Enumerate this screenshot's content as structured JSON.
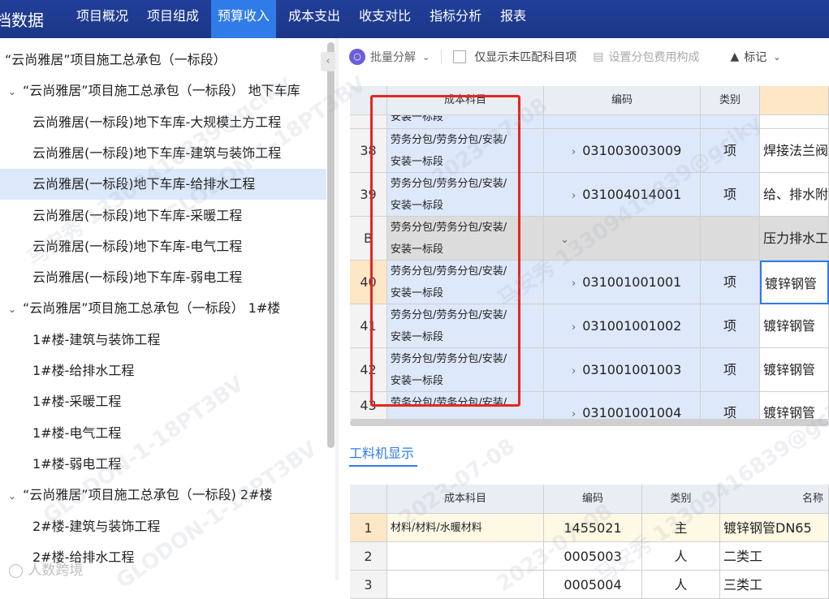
{
  "nav": {
    "app_title": "档数据",
    "tabs": [
      "项目概况",
      "项目组成",
      "预算收入",
      "成本支出",
      "收支对比",
      "指标分析",
      "报表"
    ],
    "active_tab": "预算收入"
  },
  "tree": {
    "items": [
      {
        "label": "“云尚雅居”项目施工总承包（一标段）",
        "level": 0,
        "caret": ""
      },
      {
        "label": "“云尚雅居”项目施工总承包（一标段） 地下车库",
        "level": 1,
        "caret": "⌄"
      },
      {
        "label": "云尚雅居(一标段)地下车库-大规模土方工程",
        "level": 2,
        "caret": ""
      },
      {
        "label": "云尚雅居(一标段)地下车库-建筑与装饰工程",
        "level": 2,
        "caret": ""
      },
      {
        "label": "云尚雅居(一标段)地下车库-给排水工程",
        "level": 2,
        "caret": "",
        "selected": true
      },
      {
        "label": "云尚雅居(一标段)地下车库-采暖工程",
        "level": 2,
        "caret": ""
      },
      {
        "label": "云尚雅居(一标段)地下车库-电气工程",
        "level": 2,
        "caret": ""
      },
      {
        "label": "云尚雅居(一标段)地下车库-弱电工程",
        "level": 2,
        "caret": ""
      },
      {
        "label": "“云尚雅居”项目施工总承包（一标段） 1#楼",
        "level": 1,
        "caret": "⌄"
      },
      {
        "label": "1#楼-建筑与装饰工程",
        "level": 2,
        "caret": ""
      },
      {
        "label": "1#楼-给排水工程",
        "level": 2,
        "caret": ""
      },
      {
        "label": "1#楼-采暖工程",
        "level": 2,
        "caret": ""
      },
      {
        "label": "1#楼-电气工程",
        "level": 2,
        "caret": ""
      },
      {
        "label": "1#楼-弱电工程",
        "level": 2,
        "caret": ""
      },
      {
        "label": "“云尚雅居”项目施工总承包（一标段) 2#楼",
        "level": 1,
        "caret": "⌄"
      },
      {
        "label": "2#楼-建筑与装饰工程",
        "level": 2,
        "caret": ""
      },
      {
        "label": "2#楼-给排水工程",
        "level": 2,
        "caret": ""
      }
    ]
  },
  "toolbar": {
    "batch_decompose": "批量分解",
    "only_unmatched": "仅显示未匹配科目项",
    "set_subcontract": "设置分包费用构成",
    "mark": "标记"
  },
  "main_table": {
    "headers": [
      "成本科目",
      "编码",
      "类别"
    ],
    "top_partial": "安装一标段",
    "rows": [
      {
        "num": "38",
        "subject1": "劳务分包/劳务分包/安装/",
        "subject2": "安装一标段",
        "code": "031003003009",
        "type": "项",
        "name": "焊接法兰阀门",
        "style": "blue"
      },
      {
        "num": "39",
        "subject1": "劳务分包/劳务分包/安装/",
        "subject2": "安装一标段",
        "code": "031004014001",
        "type": "项",
        "name": "给、排水附(配",
        "style": "blue"
      },
      {
        "num": "B",
        "subject1": "劳务分包/劳务分包/安装/",
        "subject2": "安装一标段",
        "code": "",
        "type": "",
        "name": "压力排水工程",
        "style": "gray"
      },
      {
        "num": "40",
        "subject1": "劳务分包/劳务分包/安装/",
        "subject2": "安装一标段",
        "code": "031001001001",
        "type": "项",
        "name": "镀锌钢管",
        "style": "blue-active"
      },
      {
        "num": "41",
        "subject1": "劳务分包/劳务分包/安装/",
        "subject2": "安装一标段",
        "code": "031001001002",
        "type": "项",
        "name": "镀锌钢管",
        "style": "blue"
      },
      {
        "num": "42",
        "subject1": "劳务分包/劳务分包/安装/",
        "subject2": "安装一标段",
        "code": "031001001003",
        "type": "项",
        "name": "镀锌钢管",
        "style": "blue"
      },
      {
        "num": "43",
        "subject1": "劳务分包/劳务分包/安装/",
        "subject2": "",
        "code": "031001001004",
        "type": "项",
        "name": "镀锌钢管",
        "style": "blue"
      }
    ]
  },
  "bottom": {
    "tab_label": "工料机显示",
    "headers": [
      "成本科目",
      "编码",
      "类别",
      "名称"
    ],
    "rows": [
      {
        "num": "1",
        "subject": "材料/材料/水暖材料",
        "code": "1455021",
        "type": "主",
        "name": "镀锌钢管DN65"
      },
      {
        "num": "2",
        "subject": "",
        "code": "0005003",
        "type": "人",
        "name": "二类工"
      },
      {
        "num": "3",
        "subject": "",
        "code": "0005004",
        "type": "人",
        "name": "三类工"
      }
    ]
  },
  "watermarks": [
    "马安秀 13309416839@gciky",
    "GLODON-1-18PT3BV",
    "2023-07-08"
  ],
  "footer_logo": "人数跨境",
  "colors": {
    "nav_bg": "#1f3a93",
    "active_tab": "#2f7be8",
    "highlight_box": "#e5261f",
    "selected_row": "#dce9fb"
  }
}
